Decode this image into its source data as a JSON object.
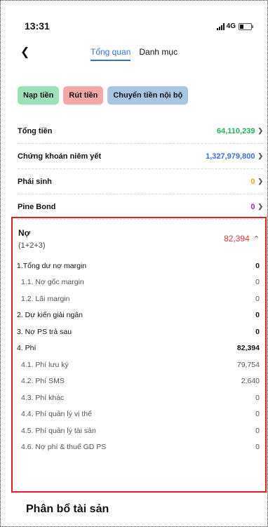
{
  "status_bar": {
    "time": "13:31",
    "network": "4G"
  },
  "nav": {
    "tabs": [
      {
        "label": "Tổng quan",
        "active": true
      },
      {
        "label": "Danh mục",
        "active": false
      }
    ]
  },
  "actions": {
    "deposit": "Nạp tiền",
    "withdraw": "Rút tiền",
    "transfer": "Chuyển tiền nội bộ"
  },
  "summary": [
    {
      "label": "Tổng tiền",
      "value": "64,110,239",
      "color": "#27ae60"
    },
    {
      "label": "Chứng khoán niêm yết",
      "value": "1,327,979,800",
      "color": "#3a6fd8"
    },
    {
      "label": "Phái sinh",
      "value": "0",
      "color": "#f5a623"
    },
    {
      "label": "Pine Bond",
      "value": "0",
      "color": "#9c27b0"
    }
  ],
  "debt": {
    "title": "Nợ",
    "subtitle": "(1+2+3)",
    "total": "82,394",
    "rows": [
      {
        "label": "1.Tổng dư nợ margin",
        "value": "0"
      },
      {
        "label": "1.1. Nợ gốc margin",
        "value": "0"
      },
      {
        "label": "1.2. Lãi margin",
        "value": "0"
      },
      {
        "label": "2. Dự kiến giải ngân",
        "value": "0"
      },
      {
        "label": "3. Nợ PS trả sau",
        "value": "0"
      },
      {
        "label": "4. Phí",
        "value": "82,394"
      },
      {
        "label": "4.1. Phí lưu ký",
        "value": "79,754"
      },
      {
        "label": "4.2. Phí SMS",
        "value": "2,640"
      },
      {
        "label": "4.3. Phí khác",
        "value": "0"
      },
      {
        "label": "4.4. Phí quản lý vị thế",
        "value": "0"
      },
      {
        "label": "4.5. Phí quản lý tài sản",
        "value": "0"
      },
      {
        "label": "4.6. Nợ phí & thuế GD PS",
        "value": "0"
      }
    ]
  },
  "section": {
    "title": "Phân bổ tài sản"
  }
}
